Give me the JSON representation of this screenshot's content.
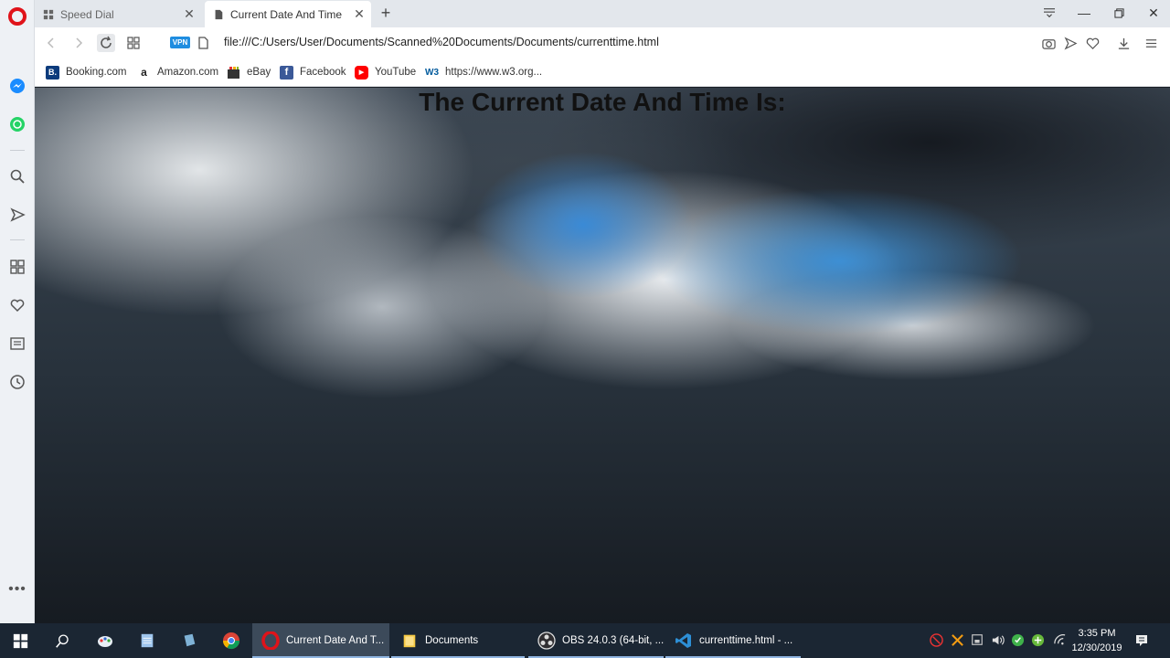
{
  "browser": {
    "tabs": [
      {
        "label": "Speed Dial",
        "active": false,
        "icon": "grid-icon"
      },
      {
        "label": "Current Date And Time",
        "active": true,
        "icon": "document-icon"
      }
    ],
    "url": "file:///C:/Users/User/Documents/Scanned%20Documents/Documents/currenttime.html",
    "vpn_label": "VPN"
  },
  "bookmarks": [
    {
      "label": "Booking.com",
      "icon": "booking-icon",
      "color": "#0c3b7c"
    },
    {
      "label": "Amazon.com",
      "icon": "amazon-icon",
      "color": "#222222"
    },
    {
      "label": "eBay",
      "icon": "ebay-icon",
      "color": "#e53238"
    },
    {
      "label": "Facebook",
      "icon": "facebook-icon",
      "color": "#3b5998"
    },
    {
      "label": "YouTube",
      "icon": "youtube-icon",
      "color": "#ff0000"
    },
    {
      "label": "https://www.w3.org...",
      "icon": "w3-icon",
      "color": "#005a9c"
    }
  ],
  "page": {
    "heading": "The Current Date And Time Is:"
  },
  "taskbar": {
    "apps": [
      {
        "label": "Current Date And T...",
        "icon": "opera-icon",
        "active": true
      },
      {
        "label": "Documents",
        "icon": "folder-icon",
        "active": false
      },
      {
        "label": "OBS 24.0.3 (64-bit, ...",
        "icon": "obs-icon",
        "active": false
      },
      {
        "label": "currenttime.html - ...",
        "icon": "vscode-icon",
        "active": false
      }
    ],
    "time": "3:35 PM",
    "date": "12/30/2019"
  },
  "colors": {
    "opera_red": "#e0131a",
    "vpn_blue": "#1f8de0",
    "taskbar": "#1b2633"
  }
}
